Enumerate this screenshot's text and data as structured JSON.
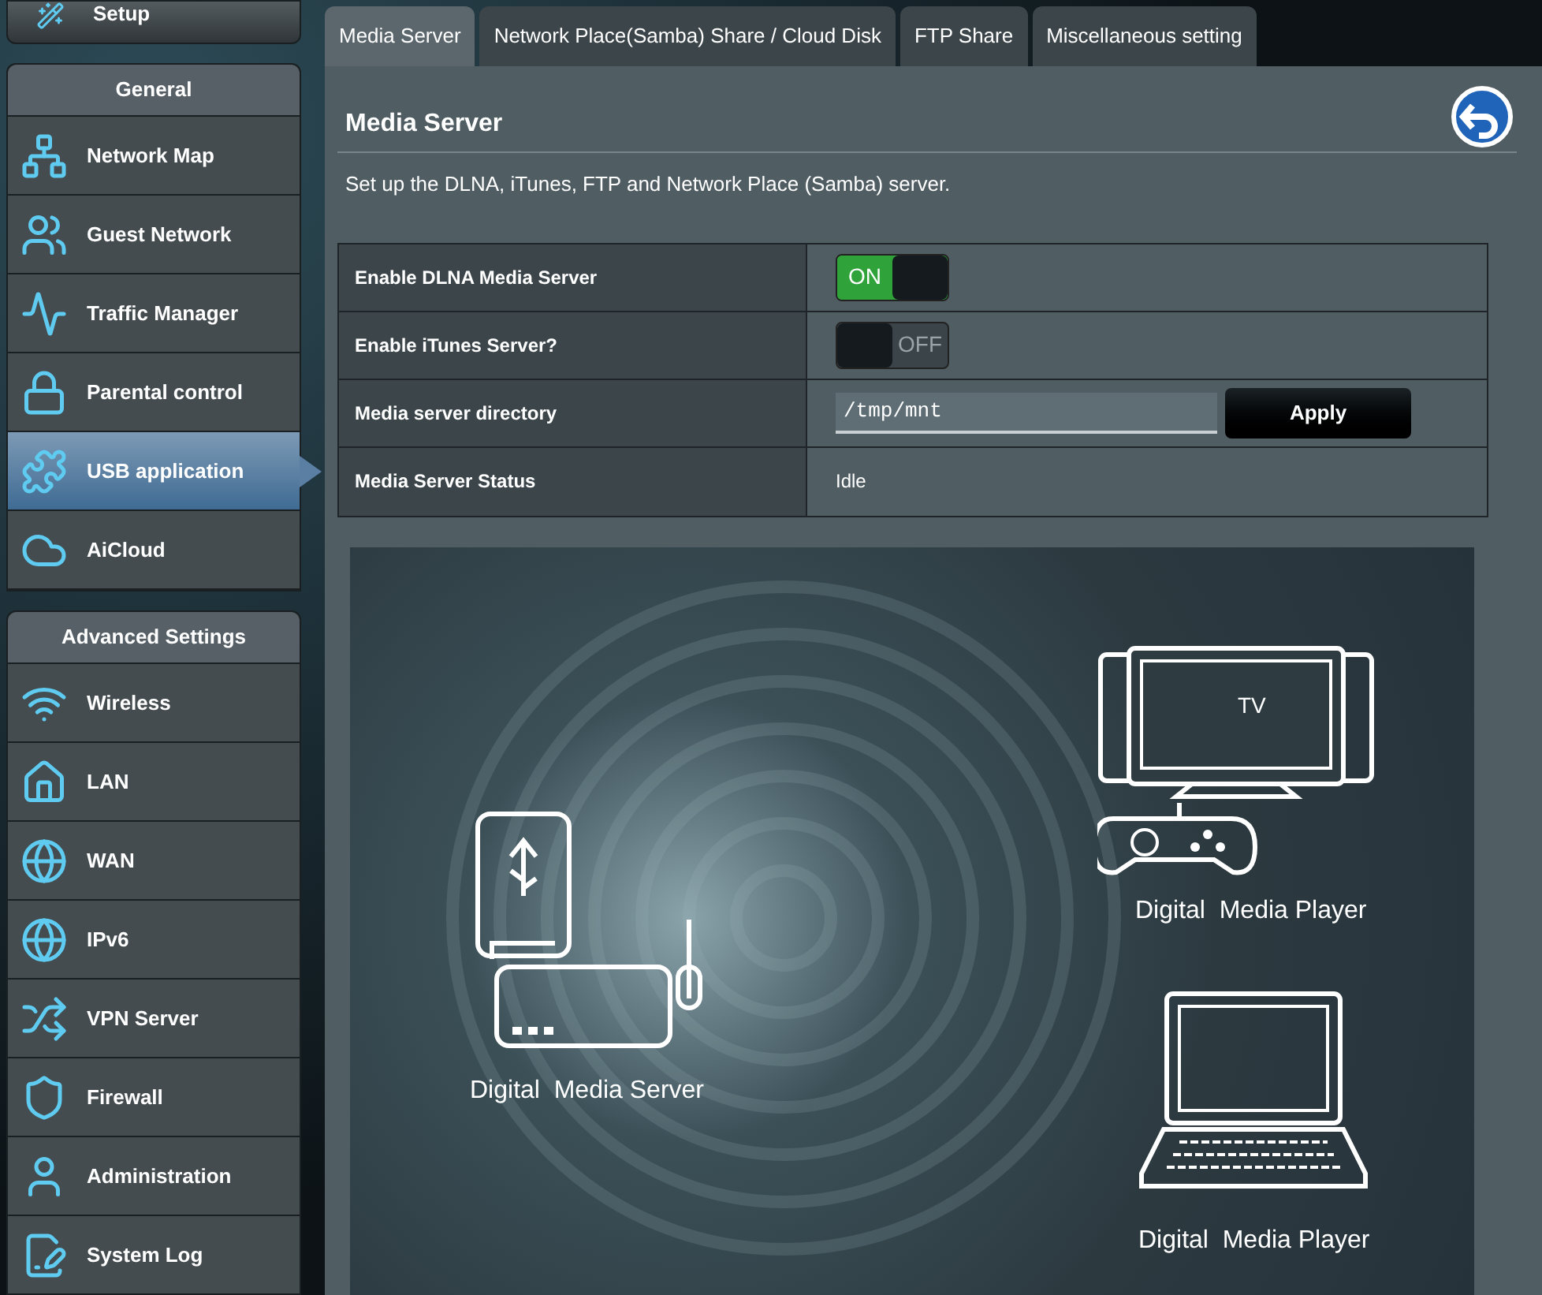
{
  "setup": {
    "label": "Setup"
  },
  "general": {
    "title": "General",
    "items": [
      {
        "label": "Network Map",
        "selected": false
      },
      {
        "label": "Guest Network",
        "selected": false
      },
      {
        "label": "Traffic Manager",
        "selected": false
      },
      {
        "label": "Parental control",
        "selected": false
      },
      {
        "label": "USB application",
        "selected": true
      },
      {
        "label": "AiCloud",
        "selected": false
      }
    ]
  },
  "advanced": {
    "title": "Advanced Settings",
    "items": [
      {
        "label": "Wireless",
        "selected": false
      },
      {
        "label": "LAN",
        "selected": false
      },
      {
        "label": "WAN",
        "selected": false
      },
      {
        "label": "IPv6",
        "selected": false
      },
      {
        "label": "VPN Server",
        "selected": false
      },
      {
        "label": "Firewall",
        "selected": false
      },
      {
        "label": "Administration",
        "selected": false
      },
      {
        "label": "System Log",
        "selected": false
      }
    ]
  },
  "tabs": [
    {
      "label": "Media Server",
      "selected": true
    },
    {
      "label": "Network Place(Samba) Share / Cloud Disk",
      "selected": false
    },
    {
      "label": "FTP Share",
      "selected": false
    },
    {
      "label": "Miscellaneous setting",
      "selected": false
    }
  ],
  "title": "Media Server",
  "description": "Set up the DLNA, iTunes, FTP and Network Place (Samba) server.",
  "settings": [
    {
      "kind": "toggle",
      "label": "Enable DLNA Media Server",
      "on": true,
      "state_text": "ON"
    },
    {
      "kind": "toggle",
      "label": "Enable iTunes Server?",
      "on": false,
      "state_text": "OFF"
    },
    {
      "kind": "input",
      "label": "Media server directory",
      "value": "/tmp/mnt",
      "button": "Apply"
    },
    {
      "kind": "text",
      "label": "Media Server Status",
      "value": "Idle"
    }
  ],
  "illustration": {
    "server_label": "Digital  Media Server",
    "tv_label": "TV",
    "player_labels": [
      "Digital  Media Player",
      "Digital  Media Player"
    ]
  }
}
